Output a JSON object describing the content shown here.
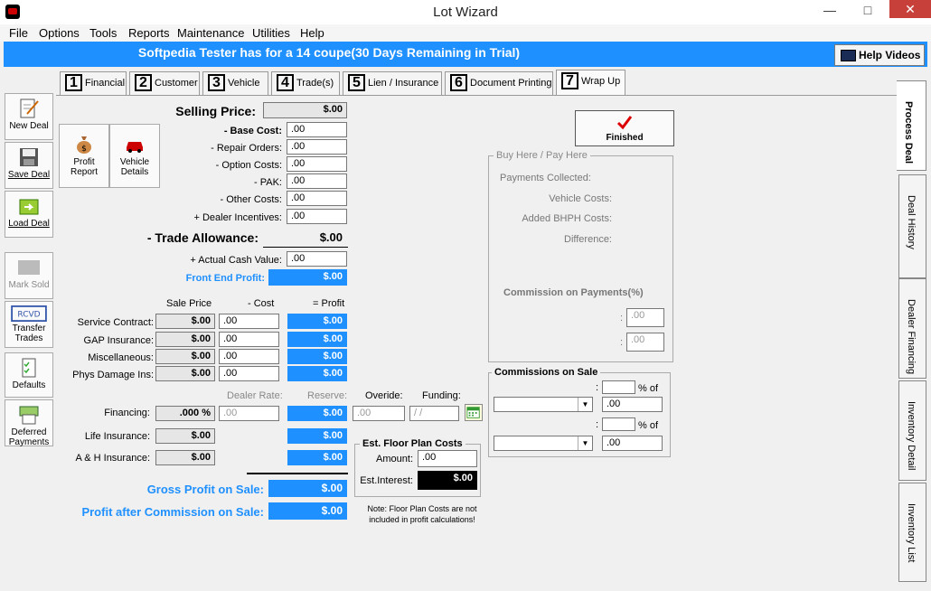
{
  "window": {
    "title": "Lot Wizard"
  },
  "menu": [
    "File",
    "Options",
    "Tools",
    "Reports",
    "Maintenance",
    "Utilities",
    "Help"
  ],
  "banner": {
    "text": "Softpedia Tester has  for a 14  coupe(30 Days Remaining in Trial)",
    "help_label": "Help Videos"
  },
  "tabs": [
    {
      "num": "1",
      "label": "Financial"
    },
    {
      "num": "2",
      "label": "Customer"
    },
    {
      "num": "3",
      "label": "Vehicle"
    },
    {
      "num": "4",
      "label": "Trade(s)"
    },
    {
      "num": "5",
      "label": "Lien / Insurance"
    },
    {
      "num": "6",
      "label": "Document Printing"
    },
    {
      "num": "7",
      "label": "Wrap Up"
    }
  ],
  "sidebar": [
    "New Deal",
    "Save Deal",
    "Load Deal",
    "Mark Sold",
    "Transfer Trades",
    "Defaults",
    "Deferred Payments"
  ],
  "right_tabs": [
    "Process Deal",
    "Deal History",
    "Dealer Financing",
    "Inventory Detail",
    "Inventory List"
  ],
  "reports": {
    "profit_report": "Profit Report",
    "vehicle_details": "Vehicle Details"
  },
  "top": {
    "selling_price_label": "Selling Price:",
    "selling_price": "$.00",
    "base_cost_label": "- Base Cost:",
    "base_cost": ".00",
    "repair_label": "- Repair Orders:",
    "repair": ".00",
    "option_label": "- Option Costs:",
    "option": ".00",
    "pak_label": "- PAK:",
    "pak": ".00",
    "other_label": "- Other Costs:",
    "other": ".00",
    "incent_label": "+ Dealer Incentives:",
    "incent": ".00",
    "trade_label": "- Trade Allowance:",
    "trade": "$.00",
    "acv_label": "+ Actual Cash Value:",
    "acv": ".00",
    "front_label": "Front End Profit:",
    "front": "$.00"
  },
  "products": {
    "headers": [
      "Sale Price",
      "- Cost",
      "= Profit"
    ],
    "rows": [
      {
        "label": "Service Contract:",
        "sale": "$.00",
        "cost": ".00",
        "profit": "$.00"
      },
      {
        "label": "GAP Insurance:",
        "sale": "$.00",
        "cost": ".00",
        "profit": "$.00"
      },
      {
        "label": "Miscellaneous:",
        "sale": "$.00",
        "cost": ".00",
        "profit": "$.00"
      },
      {
        "label": "Phys Damage Ins:",
        "sale": "$.00",
        "cost": ".00",
        "profit": "$.00"
      }
    ]
  },
  "financing": {
    "headers": {
      "rate": "Dealer Rate:",
      "reserve": "Reserve:",
      "override": "Overide:",
      "funding": "Funding:"
    },
    "label": "Financing:",
    "pct": ".000 %",
    "rate": ".00",
    "reserve": "$.00",
    "override": ".00",
    "funding": "/  /",
    "life_label": "Life Insurance:",
    "life_sale": "$.00",
    "life_profit": "$.00",
    "ah_label": "A & H Insurance:",
    "ah_sale": "$.00",
    "ah_profit": "$.00"
  },
  "floor": {
    "title": "Est. Floor Plan Costs",
    "amount_label": "Amount:",
    "amount": ".00",
    "interest_label": "Est.Interest:",
    "interest": "$.00",
    "note": "Note: Floor Plan Costs are not included in profit calculations!"
  },
  "totals": {
    "gross_label": "Gross Profit on Sale:",
    "gross": "$.00",
    "after_label": "Profit after Commission on Sale:",
    "after": "$.00"
  },
  "finished": "Finished",
  "bhph": {
    "title": "Buy Here / Pay Here",
    "collected": "Payments Collected:",
    "vehicle_costs": "Vehicle Costs:",
    "added": "Added BHPH Costs:",
    "difference": "Difference:",
    "commission": "Commission on Payments(%)",
    "val1": ".00",
    "val2": ".00"
  },
  "commissions": {
    "title": "Commissions on Sale",
    "pct_of": "% of",
    "val1": ".00",
    "val2": ".00"
  },
  "colors": {
    "accent": "#1e90ff",
    "close": "#c7413a"
  }
}
